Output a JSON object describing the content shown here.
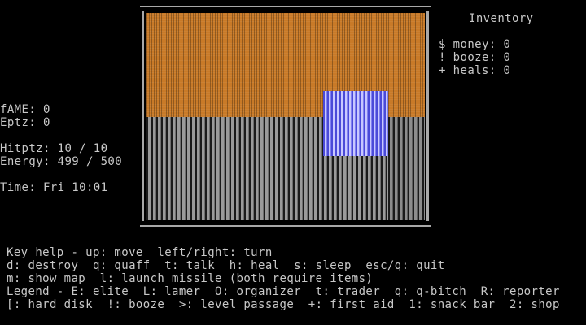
{
  "stats": {
    "fame": "fAME: 0",
    "eptz": "Eptz: 0",
    "hitptz": "Hitptz: 10 / 10",
    "energy": "Energy: 499 / 500",
    "time": "Time: Fri 10:01"
  },
  "inventory": {
    "title": "Inventory",
    "money": "$ money: 0",
    "booze": "! booze: 0",
    "heals": "+ heals: 0"
  },
  "help": {
    "line1": "Key help - up: move  left/right: turn",
    "line2": "d: destroy  q: quaff  t: talk  h: heal  s: sleep  esc/q: quit",
    "line3": "m: show map  l: launch missile (both require items)",
    "line4": "Legend - E: elite  L: lamer  O: organizer  t: trader  q: q-bitch  R: reporter",
    "line5": "[: hard disk  !: booze  >: level passage  +: first aid  1: snack bar  2: shop"
  },
  "colors": {
    "ceiling": "#c87a28",
    "floor": "#9a9a9a",
    "wall": "#8080f0",
    "text": "#c8c8c8",
    "background": "#000000"
  }
}
